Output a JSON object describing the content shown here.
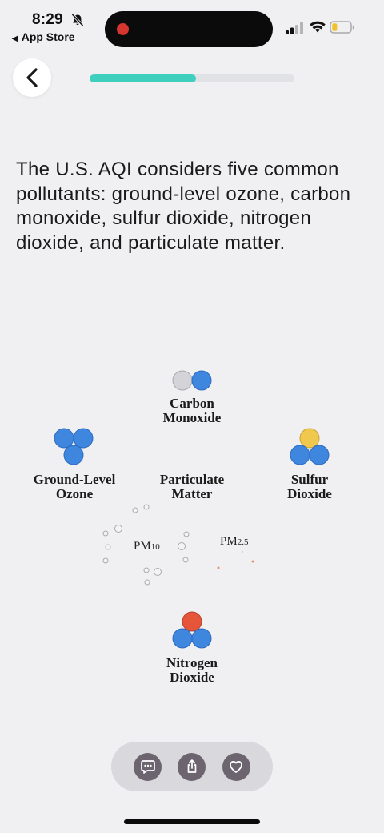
{
  "status_bar": {
    "time": "8:29",
    "back_app": "App Store",
    "mute_icon": "bell-slash-icon",
    "icons": [
      "signal-icon",
      "wifi-icon",
      "battery-low-icon"
    ]
  },
  "header": {
    "back_icon": "chevron-left-icon",
    "progress_fraction": 0.52,
    "progress_color": "#3ecfbf"
  },
  "intro_text": "The U.S. AQI considers five common pollutants: ground-level ozone, carbon monoxide, sulfur dioxide, nitrogen dioxide, and particulate matter.",
  "pollutants": {
    "carbon_monoxide": {
      "line1": "Carbon",
      "line2": "Monoxide"
    },
    "ground_level_ozone": {
      "line1": "Ground-Level",
      "line2": "Ozone"
    },
    "particulate_matter": {
      "line1": "Particulate",
      "line2": "Matter",
      "pm10": "PM",
      "pm10_sub": "10",
      "pm25": "PM",
      "pm25_sub": "2.5"
    },
    "sulfur_dioxide": {
      "line1": "Sulfur",
      "line2": "Dioxide"
    },
    "nitrogen_dioxide": {
      "line1": "Nitrogen",
      "line2": "Dioxide"
    }
  },
  "colors": {
    "oxygen_blue": "#3f86df",
    "carbon_gray": "#d4d4d8",
    "sulfur_yellow": "#f1c84e",
    "nitrogen_orange": "#e4553a",
    "background": "#f0f0f2"
  },
  "actions": [
    "chat-icon",
    "share-icon",
    "heart-icon"
  ]
}
